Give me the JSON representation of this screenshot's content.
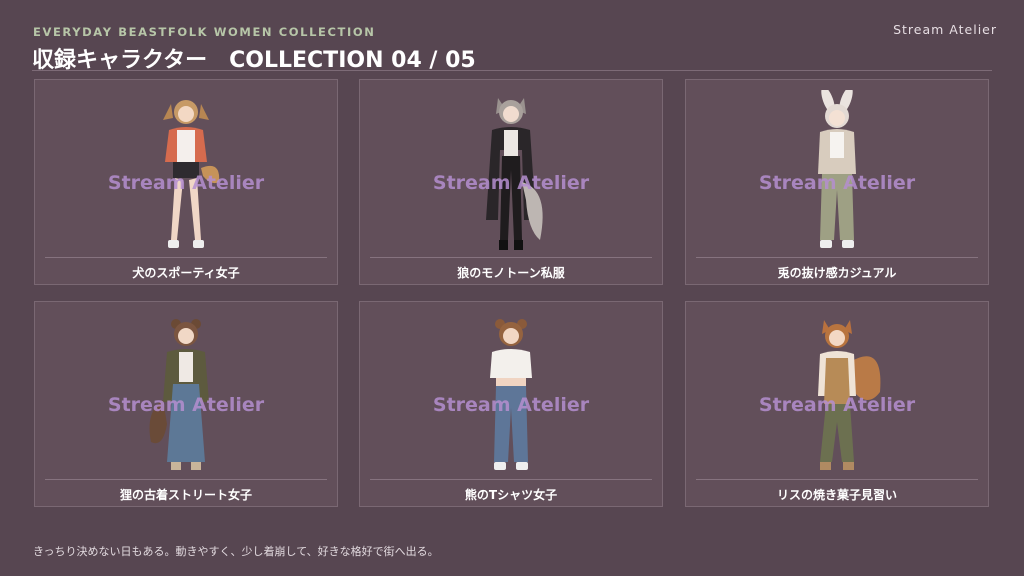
{
  "header": {
    "kicker": "EVERYDAY BEASTFOLK WOMEN COLLECTION",
    "title": "収録キャラクター",
    "subtitle": "COLLECTION 04 / 05",
    "brand": "Stream Atelier"
  },
  "cards": [
    {
      "caption": "犬のスポーティ女子",
      "watermark": "Stream Atelier"
    },
    {
      "caption": "狼のモノトーン私服",
      "watermark": "Stream Atelier"
    },
    {
      "caption": "兎の抜け感カジュアル",
      "watermark": "Stream Atelier"
    },
    {
      "caption": "狸の古着ストリート女子",
      "watermark": "Stream Atelier"
    },
    {
      "caption": "熊のTシャツ女子",
      "watermark": "Stream Atelier"
    },
    {
      "caption": "リスの焼き菓子見習い",
      "watermark": "Stream Atelier"
    }
  ],
  "footer": {
    "text": "きっちり決めない日もある。動きやすく、少し着崩して、好きな格好で街へ出る。"
  }
}
